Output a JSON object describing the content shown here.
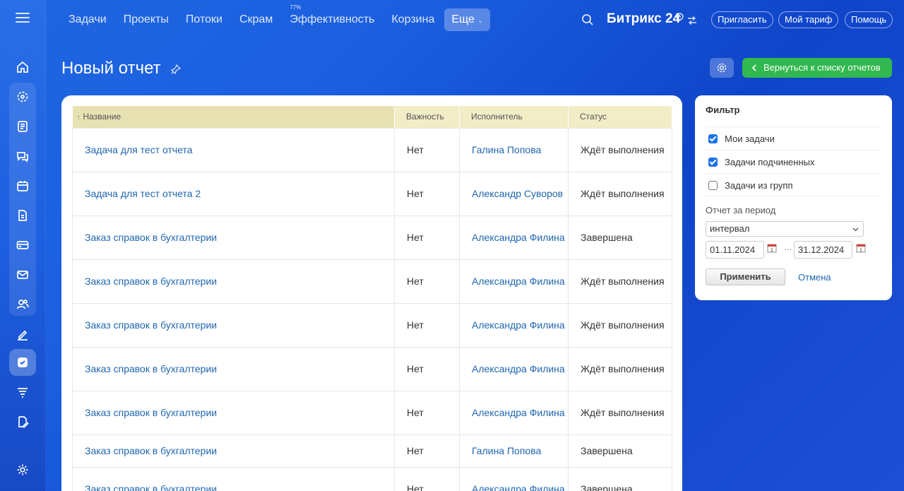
{
  "topnav": {
    "items": [
      {
        "label": "Задачи"
      },
      {
        "label": "Проекты"
      },
      {
        "label": "Потоки"
      },
      {
        "label": "Скрам"
      },
      {
        "label": "Эффективность",
        "badge": "77%"
      },
      {
        "label": "Корзина"
      }
    ],
    "more_label": "Еще",
    "brand": "Битрикс 24",
    "invite_label": "Пригласить",
    "tariff_label": "Мой тариф",
    "help_label": "Помощь"
  },
  "sidebar": {
    "icons": [
      "home-icon",
      "crm-icon",
      "feed-icon",
      "chat-icon",
      "calendar-icon",
      "documents-icon",
      "card-icon",
      "mail-icon",
      "employees-icon",
      "sign-icon",
      "tasks-icon",
      "filter-icon",
      "edit-doc-icon",
      "settings-icon"
    ]
  },
  "page": {
    "title": "Новый отчет",
    "back_label": "Вернуться к списку отчетов"
  },
  "table": {
    "headers": {
      "name": "Название",
      "importance": "Важность",
      "assignee": "Исполнитель",
      "status": "Статус"
    },
    "rows": [
      {
        "name": "Задача для тест отчета",
        "importance": "Нет",
        "assignee": "Галина Попова",
        "status": "Ждёт выполнения"
      },
      {
        "name": "Задача для тест отчета 2",
        "importance": "Нет",
        "assignee": "Александр Суворов",
        "status": "Ждёт выполнения"
      },
      {
        "name": "Заказ справок в бухгалтерии",
        "importance": "Нет",
        "assignee": "Александра Филина",
        "status": "Завершена"
      },
      {
        "name": "Заказ справок в бухгалтерии",
        "importance": "Нет",
        "assignee": "Александра Филина",
        "status": "Ждёт выполнения"
      },
      {
        "name": "Заказ справок в бухгалтерии",
        "importance": "Нет",
        "assignee": "Александра Филина",
        "status": "Ждёт выполнения"
      },
      {
        "name": "Заказ справок в бухгалтерии",
        "importance": "Нет",
        "assignee": "Александра Филина",
        "status": "Ждёт выполнения"
      },
      {
        "name": "Заказ справок в бухгалтерии",
        "importance": "Нет",
        "assignee": "Александра Филина",
        "status": "Ждёт выполнения"
      },
      {
        "name": "Заказ справок в бухгалтерии",
        "importance": "Нет",
        "assignee": "Галина Попова",
        "status": "Завершена"
      },
      {
        "name": "Заказ справок в бухгалтерии",
        "importance": "Нет",
        "assignee": "Александра Филина",
        "status": "Завершена"
      }
    ]
  },
  "filter": {
    "title": "Фильтр",
    "options": [
      {
        "label": "Мои задачи",
        "checked": true
      },
      {
        "label": "Задачи подчиненных",
        "checked": true
      },
      {
        "label": "Задачи из групп",
        "checked": false
      }
    ],
    "period_label": "Отчет за период",
    "period_value": "интервал",
    "date_from": "01.11.2024",
    "date_to": "31.12.2024",
    "apply_label": "Применить",
    "cancel_label": "Отмена"
  },
  "colors": {
    "accent_green": "#31b84f",
    "link": "#2067b0",
    "header_bg": "#f2ecc7"
  }
}
